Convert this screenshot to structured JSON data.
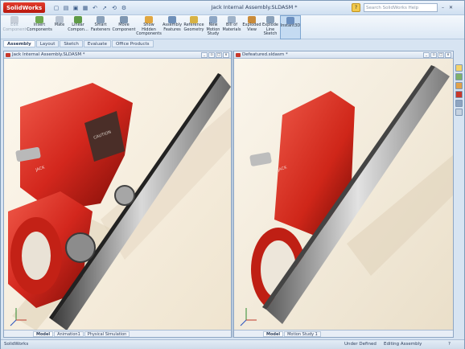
{
  "app": {
    "name": "SolidWorks",
    "document_title": "Jack Internal Assembly.SLDASM *",
    "search_placeholder": "Search SolidWorks Help",
    "help": "?"
  },
  "quick_access": [
    "new-icon",
    "open-icon",
    "save-icon",
    "print-icon",
    "undo-icon",
    "select-icon",
    "rebuild-icon",
    "options-icon"
  ],
  "ribbon": {
    "buttons": [
      {
        "label": "Edit\nComponent",
        "disabled": true
      },
      {
        "label": "Insert\nComponents"
      },
      {
        "label": "Mate"
      },
      {
        "label": "Linear\nCompon..."
      },
      {
        "label": "Smart\nFasteners"
      },
      {
        "label": "Move\nComponent"
      },
      {
        "label": "Show\nHidden\nComponents"
      },
      {
        "label": "Assembly\nFeatures"
      },
      {
        "label": "Reference\nGeometry"
      },
      {
        "label": "New\nMotion\nStudy"
      },
      {
        "label": "Bill of\nMaterials"
      },
      {
        "label": "Exploded\nView"
      },
      {
        "label": "Explode\nLine\nSketch"
      },
      {
        "label": "Instant3D",
        "active": true
      }
    ]
  },
  "command_tabs": [
    {
      "label": "Assembly",
      "active": true
    },
    {
      "label": "Layout"
    },
    {
      "label": "Sketch"
    },
    {
      "label": "Evaluate"
    },
    {
      "label": "Office Products"
    }
  ],
  "viewports": {
    "left": {
      "title": "Jack Internal Assembly.SLDASM *",
      "tabs": [
        {
          "label": "Model",
          "active": true
        },
        {
          "label": "Animation1"
        },
        {
          "label": "Physical Simulation"
        }
      ]
    },
    "right": {
      "title": "Defeatured.sldasm *",
      "tabs": [
        {
          "label": "Model",
          "active": true
        },
        {
          "label": "Motion Study 1"
        }
      ]
    }
  },
  "part_text": {
    "label_line1": "CAUTION",
    "label_line2": "JACK"
  },
  "status_bar": {
    "app": "SolidWorks",
    "definition": "Under Defined",
    "mode": "Editing Assembly",
    "help": "?"
  },
  "colors": {
    "accent_red": "#d3271d",
    "frame_blue": "#7e9ab8",
    "ribbon_bg": "#dce8f5"
  }
}
